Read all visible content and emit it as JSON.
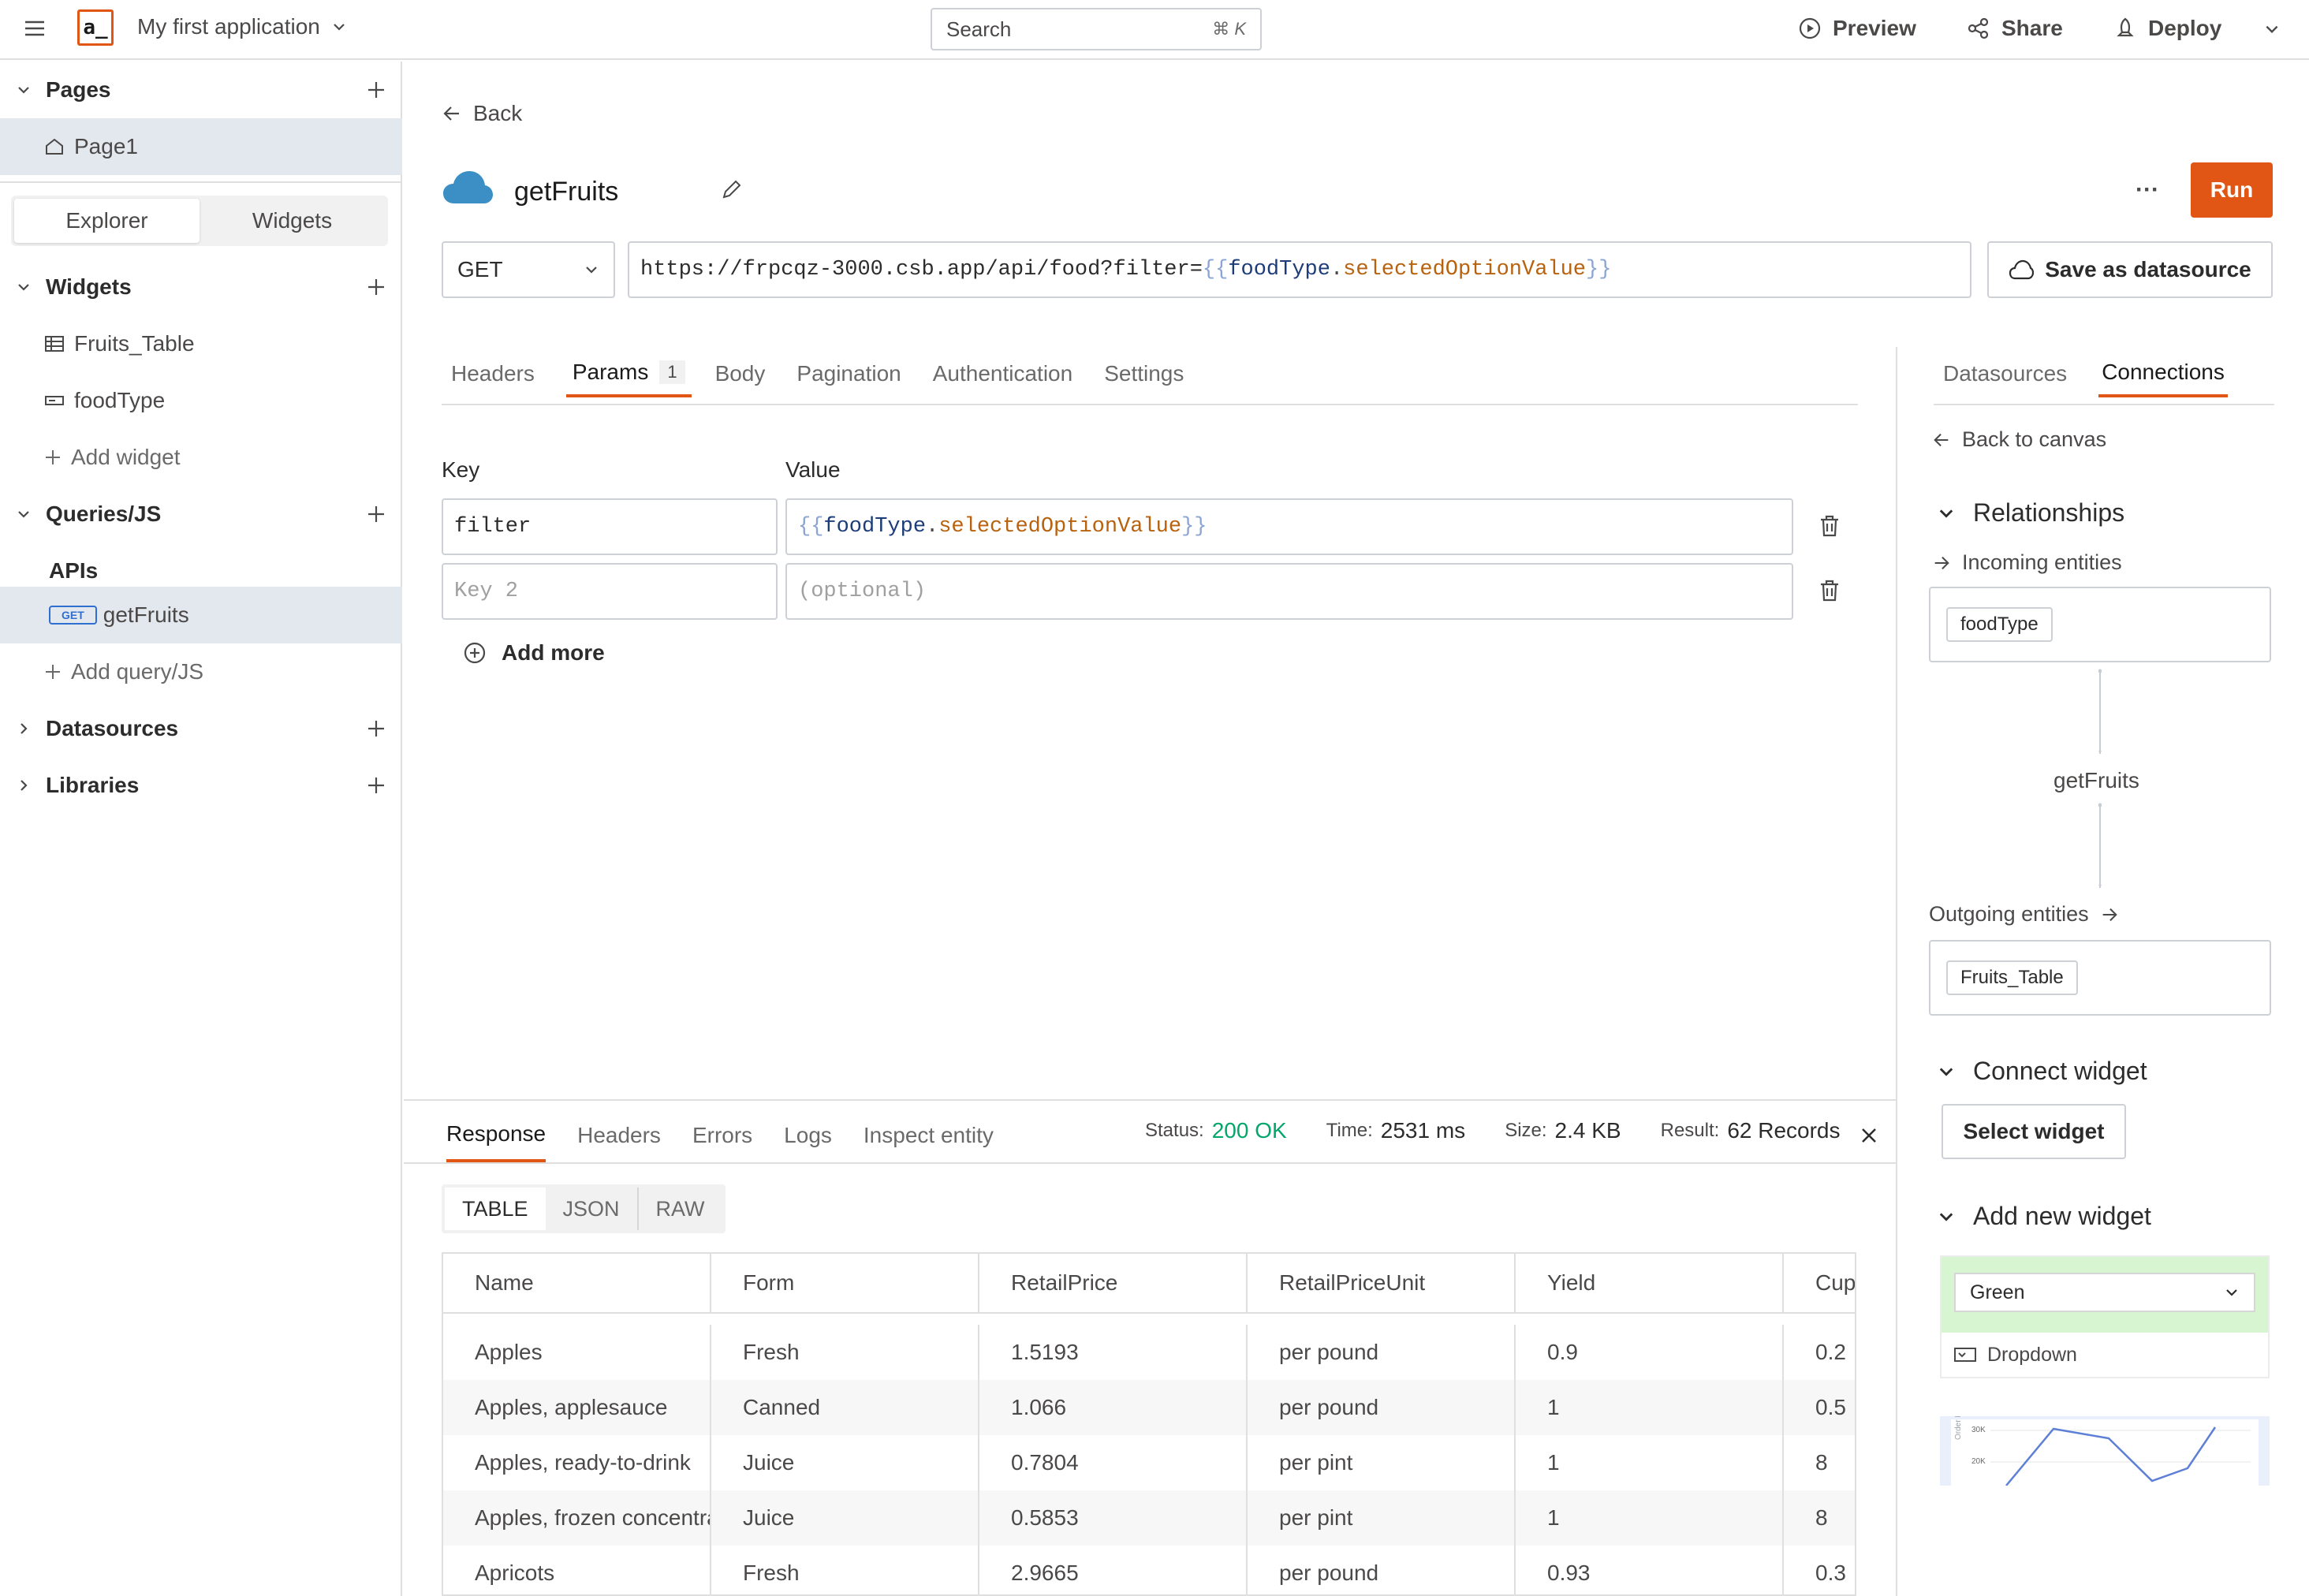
{
  "topbar": {
    "logo_text": "a_",
    "app_name": "My first application",
    "search_placeholder": "Search",
    "search_shortcut": "⌘ K",
    "preview": "Preview",
    "share": "Share",
    "deploy": "Deploy"
  },
  "sidebar": {
    "pages_title": "Pages",
    "page1": "Page1",
    "toggle_explorer": "Explorer",
    "toggle_widgets": "Widgets",
    "widgets_title": "Widgets",
    "widget_items": [
      "Fruits_Table",
      "foodType"
    ],
    "add_widget": "Add widget",
    "queries_title": "Queries/JS",
    "apis_label": "APIs",
    "query_method": "GET",
    "query_name": "getFruits",
    "add_query": "Add query/JS",
    "datasources": "Datasources",
    "libraries": "Libraries"
  },
  "editor": {
    "back": "Back",
    "query_title": "getFruits",
    "more": "···",
    "run": "Run",
    "method": "GET",
    "url_base": "https://frpcqz-3000.csb.app/api/food?filter=",
    "url_brace_open": "{{",
    "url_obj": "foodType",
    "url_dot": ".",
    "url_prop": "selectedOptionValue",
    "url_brace_close": "}}",
    "save_datasource": "Save as datasource",
    "tabs": [
      "Headers",
      "Params",
      "Body",
      "Pagination",
      "Authentication",
      "Settings"
    ],
    "params_count": "1",
    "key_header": "Key",
    "value_header": "Value",
    "param_key": "filter",
    "param_value_brace_open": "{{",
    "param_value_obj": "foodType",
    "param_value_dot": ".",
    "param_value_prop": "selectedOptionValue",
    "param_value_brace_close": "}}",
    "key2_placeholder": "Key 2",
    "value2_placeholder": "(optional)",
    "add_more": "Add more"
  },
  "response": {
    "tabs": [
      "Response",
      "Headers",
      "Errors",
      "Logs",
      "Inspect entity"
    ],
    "status_label": "Status:",
    "status_value": "200 OK",
    "time_label": "Time:",
    "time_value": "2531 ms",
    "size_label": "Size:",
    "size_value": "2.4 KB",
    "result_label": "Result:",
    "result_value": "62 Records",
    "format_tabs": [
      "TABLE",
      "JSON",
      "RAW"
    ],
    "columns": [
      "Name",
      "Form",
      "RetailPrice",
      "RetailPriceUnit",
      "Yield",
      "Cup"
    ],
    "rows": [
      [
        "Apples",
        "Fresh",
        "1.5193",
        "per pound",
        "0.9",
        "0.2"
      ],
      [
        "Apples, applesauce",
        "Canned",
        "1.066",
        "per pound",
        "1",
        "0.5"
      ],
      [
        "Apples, ready-to-drink",
        "Juice",
        "0.7804",
        "per pint",
        "1",
        "8"
      ],
      [
        "Apples, frozen concentrate",
        "Juice",
        "0.5853",
        "per pint",
        "1",
        "8"
      ],
      [
        "Apricots",
        "Fresh",
        "2.9665",
        "per pound",
        "0.93",
        "0.3"
      ]
    ]
  },
  "right_panel": {
    "tab_datasources": "Datasources",
    "tab_connections": "Connections",
    "back_to_canvas": "Back to canvas",
    "relationships": "Relationships",
    "incoming": "Incoming entities",
    "incoming_entity": "foodType",
    "center_entity": "getFruits",
    "outgoing": "Outgoing entities",
    "outgoing_entity": "Fruits_Table",
    "connect_widget": "Connect widget",
    "select_widget": "Select widget",
    "add_new_widget": "Add new widget",
    "dropdown_preview_value": "Green",
    "dropdown_label": "Dropdown",
    "chart_tick_30k": "30K",
    "chart_tick_20k": "20K",
    "chart_axis_label": "Order Revenue"
  },
  "colors": {
    "accent": "#e15615",
    "success": "#03a66b",
    "selected_bg": "#e3e8ef"
  }
}
